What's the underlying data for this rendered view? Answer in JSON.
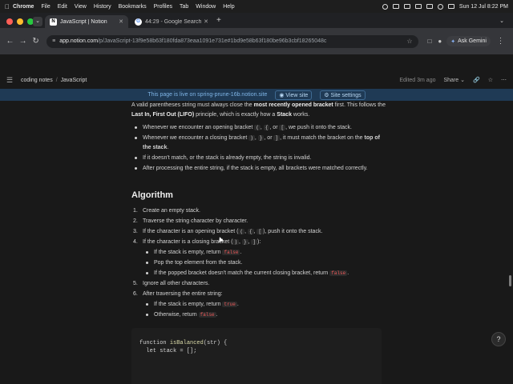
{
  "menubar": {
    "app": "Chrome",
    "items": [
      "File",
      "Edit",
      "View",
      "History",
      "Bookmarks",
      "Profiles",
      "Tab",
      "Window",
      "Help"
    ],
    "datetime": "Sun 12 Jul  8:22 PM"
  },
  "tabs": [
    {
      "label": "JavaScript | Notion",
      "icon": "notion-icon"
    },
    {
      "label": "44:29 - Google Search",
      "icon": "google-icon"
    }
  ],
  "address": {
    "host": "app.notion.com",
    "path": "/p/JavaScript-13f9e58b63f180fda873eaa1091e731e#1bd9e58b63f180be96b3cbf18265048c"
  },
  "gemini_label": "Ask Gemini",
  "notion": {
    "breadcrumb": [
      "coding notes",
      "JavaScript"
    ],
    "edited": "Edited 3m ago",
    "share": "Share",
    "banner_text": "This page is live on spring-prune-16b.notion.site",
    "view_site": "View site",
    "site_settings": "Site settings"
  },
  "content": {
    "intro_1": "A valid parentheses string must always close the ",
    "intro_bold_1": "most recently opened bracket",
    "intro_2": " first. This follows the ",
    "intro_bold_2": "Last In, First Out (LIFO)",
    "intro_3": " principle, which is exactly how a ",
    "intro_bold_3": "Stack",
    "intro_4": " works.",
    "bullets": {
      "b1_a": "Whenever we encounter an opening bracket ",
      "b1_b": ", ",
      "b1_c": ", or ",
      "b1_d": ", we push it onto the stack.",
      "b2_a": "Whenever we encounter a closing bracket ",
      "b2_b": ", ",
      "b2_c": ", or ",
      "b2_d": ", it must match the bracket on the ",
      "b2_bold": "top of the stack",
      "b2_e": ".",
      "b3": "If it doesn't match, or the stack is already empty, the string is invalid.",
      "b4": "After processing the entire string, if the stack is empty, all brackets were matched correctly."
    },
    "open_brackets": [
      "(",
      "{",
      "["
    ],
    "close_brackets": [
      ")",
      "}",
      "]"
    ],
    "heading": "Algorithm",
    "steps": {
      "s1": "Create an empty stack.",
      "s2": "Traverse the string character by character.",
      "s3_a": "If the character is an opening bracket (",
      "s3_b": "), push it onto the stack.",
      "s4_a": "If the character is a closing bracket (",
      "s4_b": "):",
      "s4_sub1_a": "If the stack is empty, return ",
      "s4_sub1_code": "false",
      "s4_sub2": "Pop the top element from the stack.",
      "s4_sub3_a": "If the popped bracket doesn't match the current closing bracket, return ",
      "s4_sub3_code": "false",
      "s5": "Ignore all other characters.",
      "s6": "After traversing the entire string:",
      "s6_sub1_a": "If the stack is empty, return ",
      "s6_sub1_code": "true",
      "s6_sub2_a": "Otherwise, return ",
      "s6_sub2_code": "false"
    },
    "numbers": [
      "1.",
      "2.",
      "3.",
      "4.",
      "5.",
      "6."
    ],
    "code_line1_kw": "function ",
    "code_line1_fn": "isBalanced",
    "code_line1_rest": "(str) {",
    "code_line2": "  let stack = [];"
  },
  "help": "?"
}
